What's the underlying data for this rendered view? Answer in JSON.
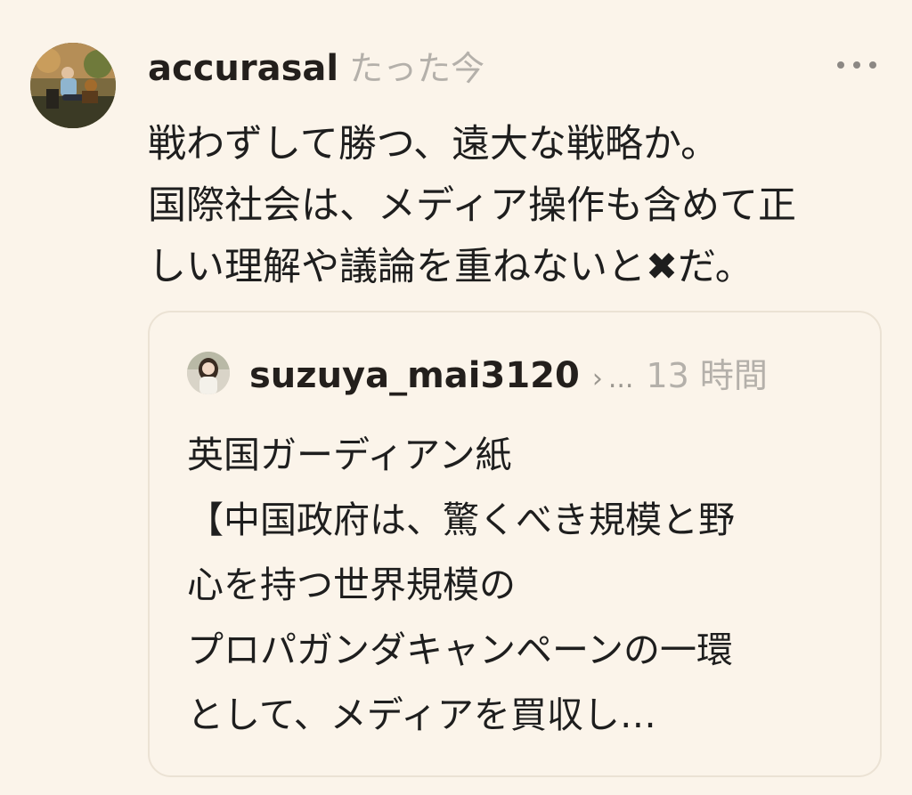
{
  "post": {
    "author": "accurasal",
    "time": "たった今",
    "more_icon": "more-horizontal-icon",
    "lines": [
      "戦わずして勝つ、遠大な戦略か。",
      "国際社会は、メディア操作も含めて正",
      "しい理解や議論を重ねないと✖だ。"
    ]
  },
  "quote": {
    "author": "suzuya_mai3120",
    "chevron": "›",
    "ellipsis": "...",
    "time": "13 時間",
    "lines": [
      "英国ガーディアン紙",
      "【中国政府は、驚くべき規模と野",
      "心を持つ世界規模の",
      "プロパガンダキャンペーンの一環",
      "として、メディアを買収し…"
    ]
  },
  "colors": {
    "background": "#fbf4ea",
    "text": "#1e1e1e",
    "muted": "#b4b0aa",
    "card_border": "#ebe2d4"
  }
}
